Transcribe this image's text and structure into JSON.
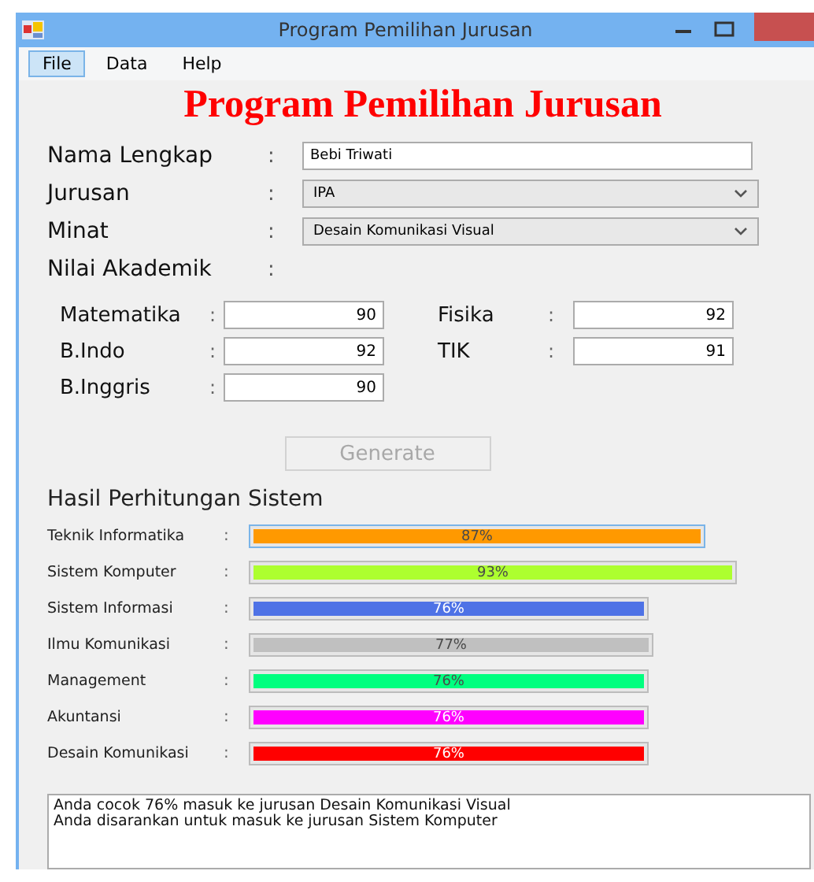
{
  "window": {
    "title": "Program Pemilihan Jurusan"
  },
  "menu": [
    {
      "label": "File",
      "selected": true
    },
    {
      "label": "Data",
      "selected": false
    },
    {
      "label": "Help",
      "selected": false
    }
  ],
  "heading": "Program Pemilihan Jurusan",
  "form": {
    "nama": {
      "label": "Nama Lengkap",
      "colon": ":",
      "value": "Bebi Triwati"
    },
    "jurusan": {
      "label": "Jurusan",
      "colon": ":",
      "value": "IPA"
    },
    "minat": {
      "label": "Minat",
      "colon": ":",
      "value": "Desain Komunikasi Visual"
    },
    "nilai": {
      "label": "Nilai Akademik",
      "colon": ":"
    }
  },
  "grades": [
    {
      "label": "Matematika",
      "colon": ":",
      "value": "90"
    },
    {
      "label": "Fisika",
      "colon": ":",
      "value": "92"
    },
    {
      "label": "B.Indo",
      "colon": ":",
      "value": "92"
    },
    {
      "label": "TIK",
      "colon": ":",
      "value": "91"
    },
    {
      "label": "B.Inggris",
      "colon": ":",
      "value": "90"
    }
  ],
  "generate": {
    "label": "Generate",
    "disabled": true
  },
  "results_title": "Hasil Perhitungan Sistem",
  "results": [
    {
      "name": "Teknik Informatika",
      "colon": ":",
      "reading": "87%",
      "color": "#ff9900",
      "focused": true
    },
    {
      "name": "Sistem Komputer",
      "colon": ":",
      "reading": "93%",
      "color": "#adff2f",
      "focused": false
    },
    {
      "name": "Sistem Informasi",
      "colon": ":",
      "reading": "76%",
      "color": "#4e72e6",
      "focused": false
    },
    {
      "name": "Ilmu Komunikasi",
      "colon": ":",
      "reading": "77%",
      "color": "#c0c0c0",
      "focused": false
    },
    {
      "name": "Management",
      "colon": ":",
      "reading": "76%",
      "color": "#00ff7f",
      "focused": false
    },
    {
      "name": "Akuntansi",
      "colon": ":",
      "reading": "76%",
      "color": "#ff00ff",
      "focused": false
    },
    {
      "name": "Desain Komunikasi",
      "colon": ":",
      "reading": "76%",
      "color": "#ff0000",
      "focused": false
    }
  ],
  "output_lines": [
    "Anda cocok 76% masuk ke jurusan Desain Komunikasi Visual",
    "Anda disarankan untuk masuk ke jurusan Sistem Komputer"
  ]
}
